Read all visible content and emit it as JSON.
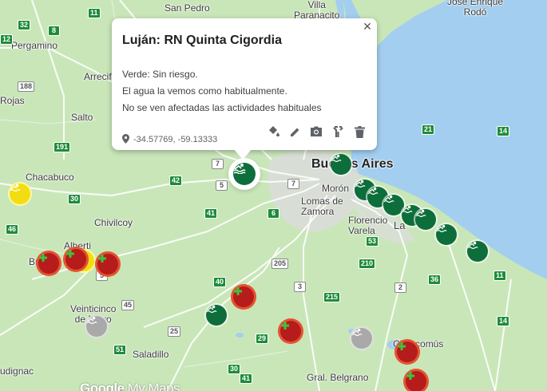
{
  "popup": {
    "title": "Luján: RN Quinta Cigordia",
    "description": [
      "Verde: Sin riesgo.",
      "El agua la vemos como habitualmente.",
      "No se ven afectadas las actividades habituales"
    ],
    "coords": "-34.57769, -59.13333",
    "close_icon": "close-icon",
    "tools": [
      "paint-bucket-icon",
      "pencil-icon",
      "camera-icon",
      "directions-icon",
      "trash-icon"
    ]
  },
  "places": {
    "san_pedro": "San Pedro",
    "villa_paranacito": "Villa\nParanacito",
    "jose_enrique_rodo": "José Enrique\nRodó",
    "pergamino": "Pergamino",
    "arrecifes": "Arrecif",
    "rojas": "Rojas",
    "salto": "Salto",
    "chacabuco": "Chacabuco",
    "chivilcoy": "Chivilcoy",
    "alberti": "Alberti",
    "bragado": "Br",
    "veinticinco_de_mayo": "Veinticinco\nde Mayo",
    "saladillo": "Saladillo",
    "rudignac": "udignac",
    "buenos_aires": "Buenos Aires",
    "moron": "Morón",
    "lomas_de_zamora": "Lomas de\nZamora",
    "florencio_varela": "Florencio\nVarela",
    "la_plata": "La",
    "chascomus": "Chascomús",
    "gral_belgrano": "Gral. Belgrano"
  },
  "routes": [
    "32",
    "11",
    "8",
    "12",
    "188",
    "191",
    "30",
    "42",
    "7",
    "5",
    "41",
    "6",
    "46",
    "205",
    "40",
    "3",
    "215",
    "51",
    "25",
    "29",
    "53",
    "210",
    "2",
    "36",
    "11",
    "21",
    "14",
    "45",
    "5",
    "30",
    "41",
    "7",
    "14"
  ],
  "marker_colors": {
    "green": "#0d6e3b",
    "red": "#b61c1c",
    "yellow": "#f2dd12",
    "grey": "#a9a9a9"
  },
  "branding": {
    "google": "Google",
    "my_maps": "My Maps"
  }
}
